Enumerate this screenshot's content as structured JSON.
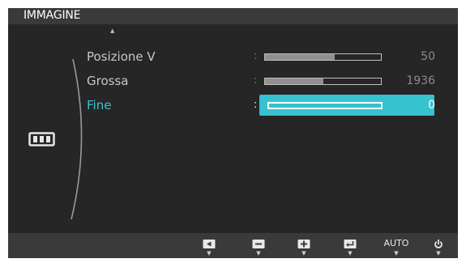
{
  "menu": {
    "title": "IMMAGINE",
    "scroll_indicator": "▲",
    "side_icon": "image-size-icon",
    "items": [
      {
        "label": "Posizione V",
        "separator": ":",
        "value": "50",
        "level": 0.6,
        "selected": false
      },
      {
        "label": "Grossa",
        "separator": ":",
        "value": "1936",
        "level": 0.5,
        "selected": false
      },
      {
        "label": "Fine",
        "separator": ":",
        "value": "0",
        "level": 0.0,
        "selected": true
      }
    ]
  },
  "navigation": {
    "buttons": [
      {
        "icon": "left-arrow-icon",
        "indicator": "▼"
      },
      {
        "icon": "minus-icon",
        "indicator": "▼"
      },
      {
        "icon": "plus-icon",
        "indicator": "▼"
      },
      {
        "icon": "enter-icon",
        "indicator": "▼"
      },
      {
        "label": "AUTO",
        "indicator": "▼"
      },
      {
        "icon": "power-icon",
        "indicator": "▼"
      }
    ]
  },
  "colors": {
    "accent": "#36c2cf",
    "panel": "#262626",
    "bar": "#3a3a3a"
  }
}
